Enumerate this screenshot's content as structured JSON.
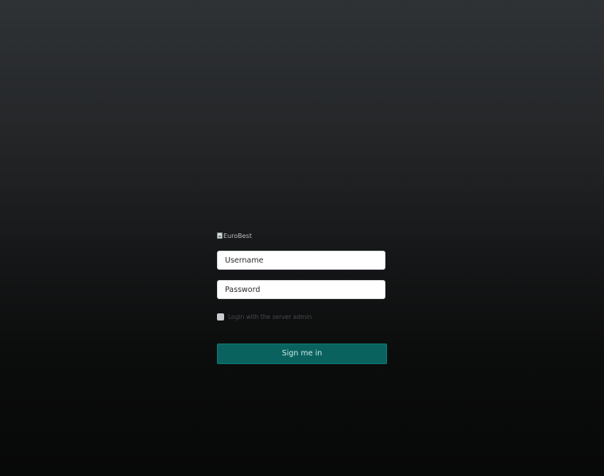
{
  "logo": {
    "alt_text": "EuroBest"
  },
  "form": {
    "username": {
      "placeholder": "Username",
      "value": ""
    },
    "password": {
      "placeholder": "Password",
      "value": ""
    },
    "server_admin_label": "Login with the server admin",
    "server_admin_checked": false,
    "submit_label": "Sign me in"
  },
  "colors": {
    "primary_button": "#0a625f",
    "background_top": "#2f3235",
    "background_bottom": "#070808"
  }
}
